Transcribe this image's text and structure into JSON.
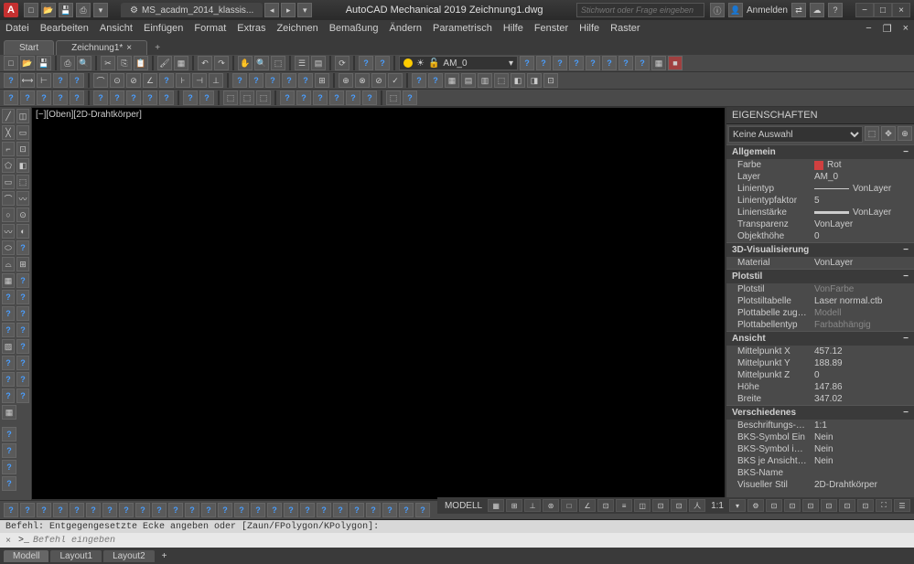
{
  "title": "AutoCAD Mechanical 2019    Zeichnung1.dwg",
  "app_tab": "MS_acadm_2014_klassis...",
  "search_placeholder": "Stichwort oder Frage eingeben",
  "login": "Anmelden",
  "menu": [
    "Datei",
    "Bearbeiten",
    "Ansicht",
    "Einfügen",
    "Format",
    "Extras",
    "Zeichnen",
    "Bemaßung",
    "Ändern",
    "Parametrisch",
    "Hilfe",
    "Fenster",
    "Hilfe",
    "Raster"
  ],
  "doc_tabs": {
    "start": "Start",
    "drawing": "Zeichnung1*"
  },
  "layer_current": "AM_0",
  "viewport_label": "[−][Oben][2D-Drahtkörper]",
  "properties": {
    "panel_title": "EIGENSCHAFTEN",
    "selection": "Keine Auswahl",
    "sections": {
      "allgemein": {
        "title": "Allgemein",
        "rows": [
          {
            "k": "Farbe",
            "v": "Rot",
            "swatch": true
          },
          {
            "k": "Layer",
            "v": "AM_0"
          },
          {
            "k": "Linientyp",
            "v": "VonLayer",
            "line": true
          },
          {
            "k": "Linientypfaktor",
            "v": "5"
          },
          {
            "k": "Linienstärke",
            "v": "VonLayer",
            "lineThick": true
          },
          {
            "k": "Transparenz",
            "v": "VonLayer"
          },
          {
            "k": "Objekthöhe",
            "v": "0"
          }
        ]
      },
      "vis3d": {
        "title": "3D-Visualisierung",
        "rows": [
          {
            "k": "Material",
            "v": "VonLayer"
          }
        ]
      },
      "plotstil": {
        "title": "Plotstil",
        "rows": [
          {
            "k": "Plotstil",
            "v": "VonFarbe",
            "dim": true
          },
          {
            "k": "Plotstiltabelle",
            "v": "Laser normal.ctb"
          },
          {
            "k": "Plottabelle  zugeordn...",
            "v": "Modell",
            "dim": true
          },
          {
            "k": "Plottabellentyp",
            "v": "Farbabhängig",
            "dim": true
          }
        ]
      },
      "ansicht": {
        "title": "Ansicht",
        "rows": [
          {
            "k": "Mittelpunkt X",
            "v": "457.12"
          },
          {
            "k": "Mittelpunkt Y",
            "v": "188.89"
          },
          {
            "k": "Mittelpunkt Z",
            "v": "0"
          },
          {
            "k": "Höhe",
            "v": "147.86"
          },
          {
            "k": "Breite",
            "v": "347.02"
          }
        ]
      },
      "verschiedenes": {
        "title": "Verschiedenes",
        "rows": [
          {
            "k": "Beschriftungs-Maßst...",
            "v": "1:1"
          },
          {
            "k": "BKS-Symbol Ein",
            "v": "Nein"
          },
          {
            "k": "BKS-Symbol  im  Ursp...",
            "v": "Nein"
          },
          {
            "k": "BKS je Ansichtsfenster",
            "v": "Nein"
          },
          {
            "k": "BKS-Name",
            "v": ""
          },
          {
            "k": "Visueller Stil",
            "v": "2D-Drahtkörper"
          }
        ]
      }
    }
  },
  "command": {
    "history": "Befehl: Entgegengesetzte Ecke angeben oder [Zaun/FPolygon/KPolygon]:",
    "prompt": ">_",
    "placeholder": "Befehl eingeben"
  },
  "layout_tabs": [
    "Modell",
    "Layout1",
    "Layout2"
  ],
  "status": {
    "model": "MODELL",
    "scale": "1:1"
  }
}
